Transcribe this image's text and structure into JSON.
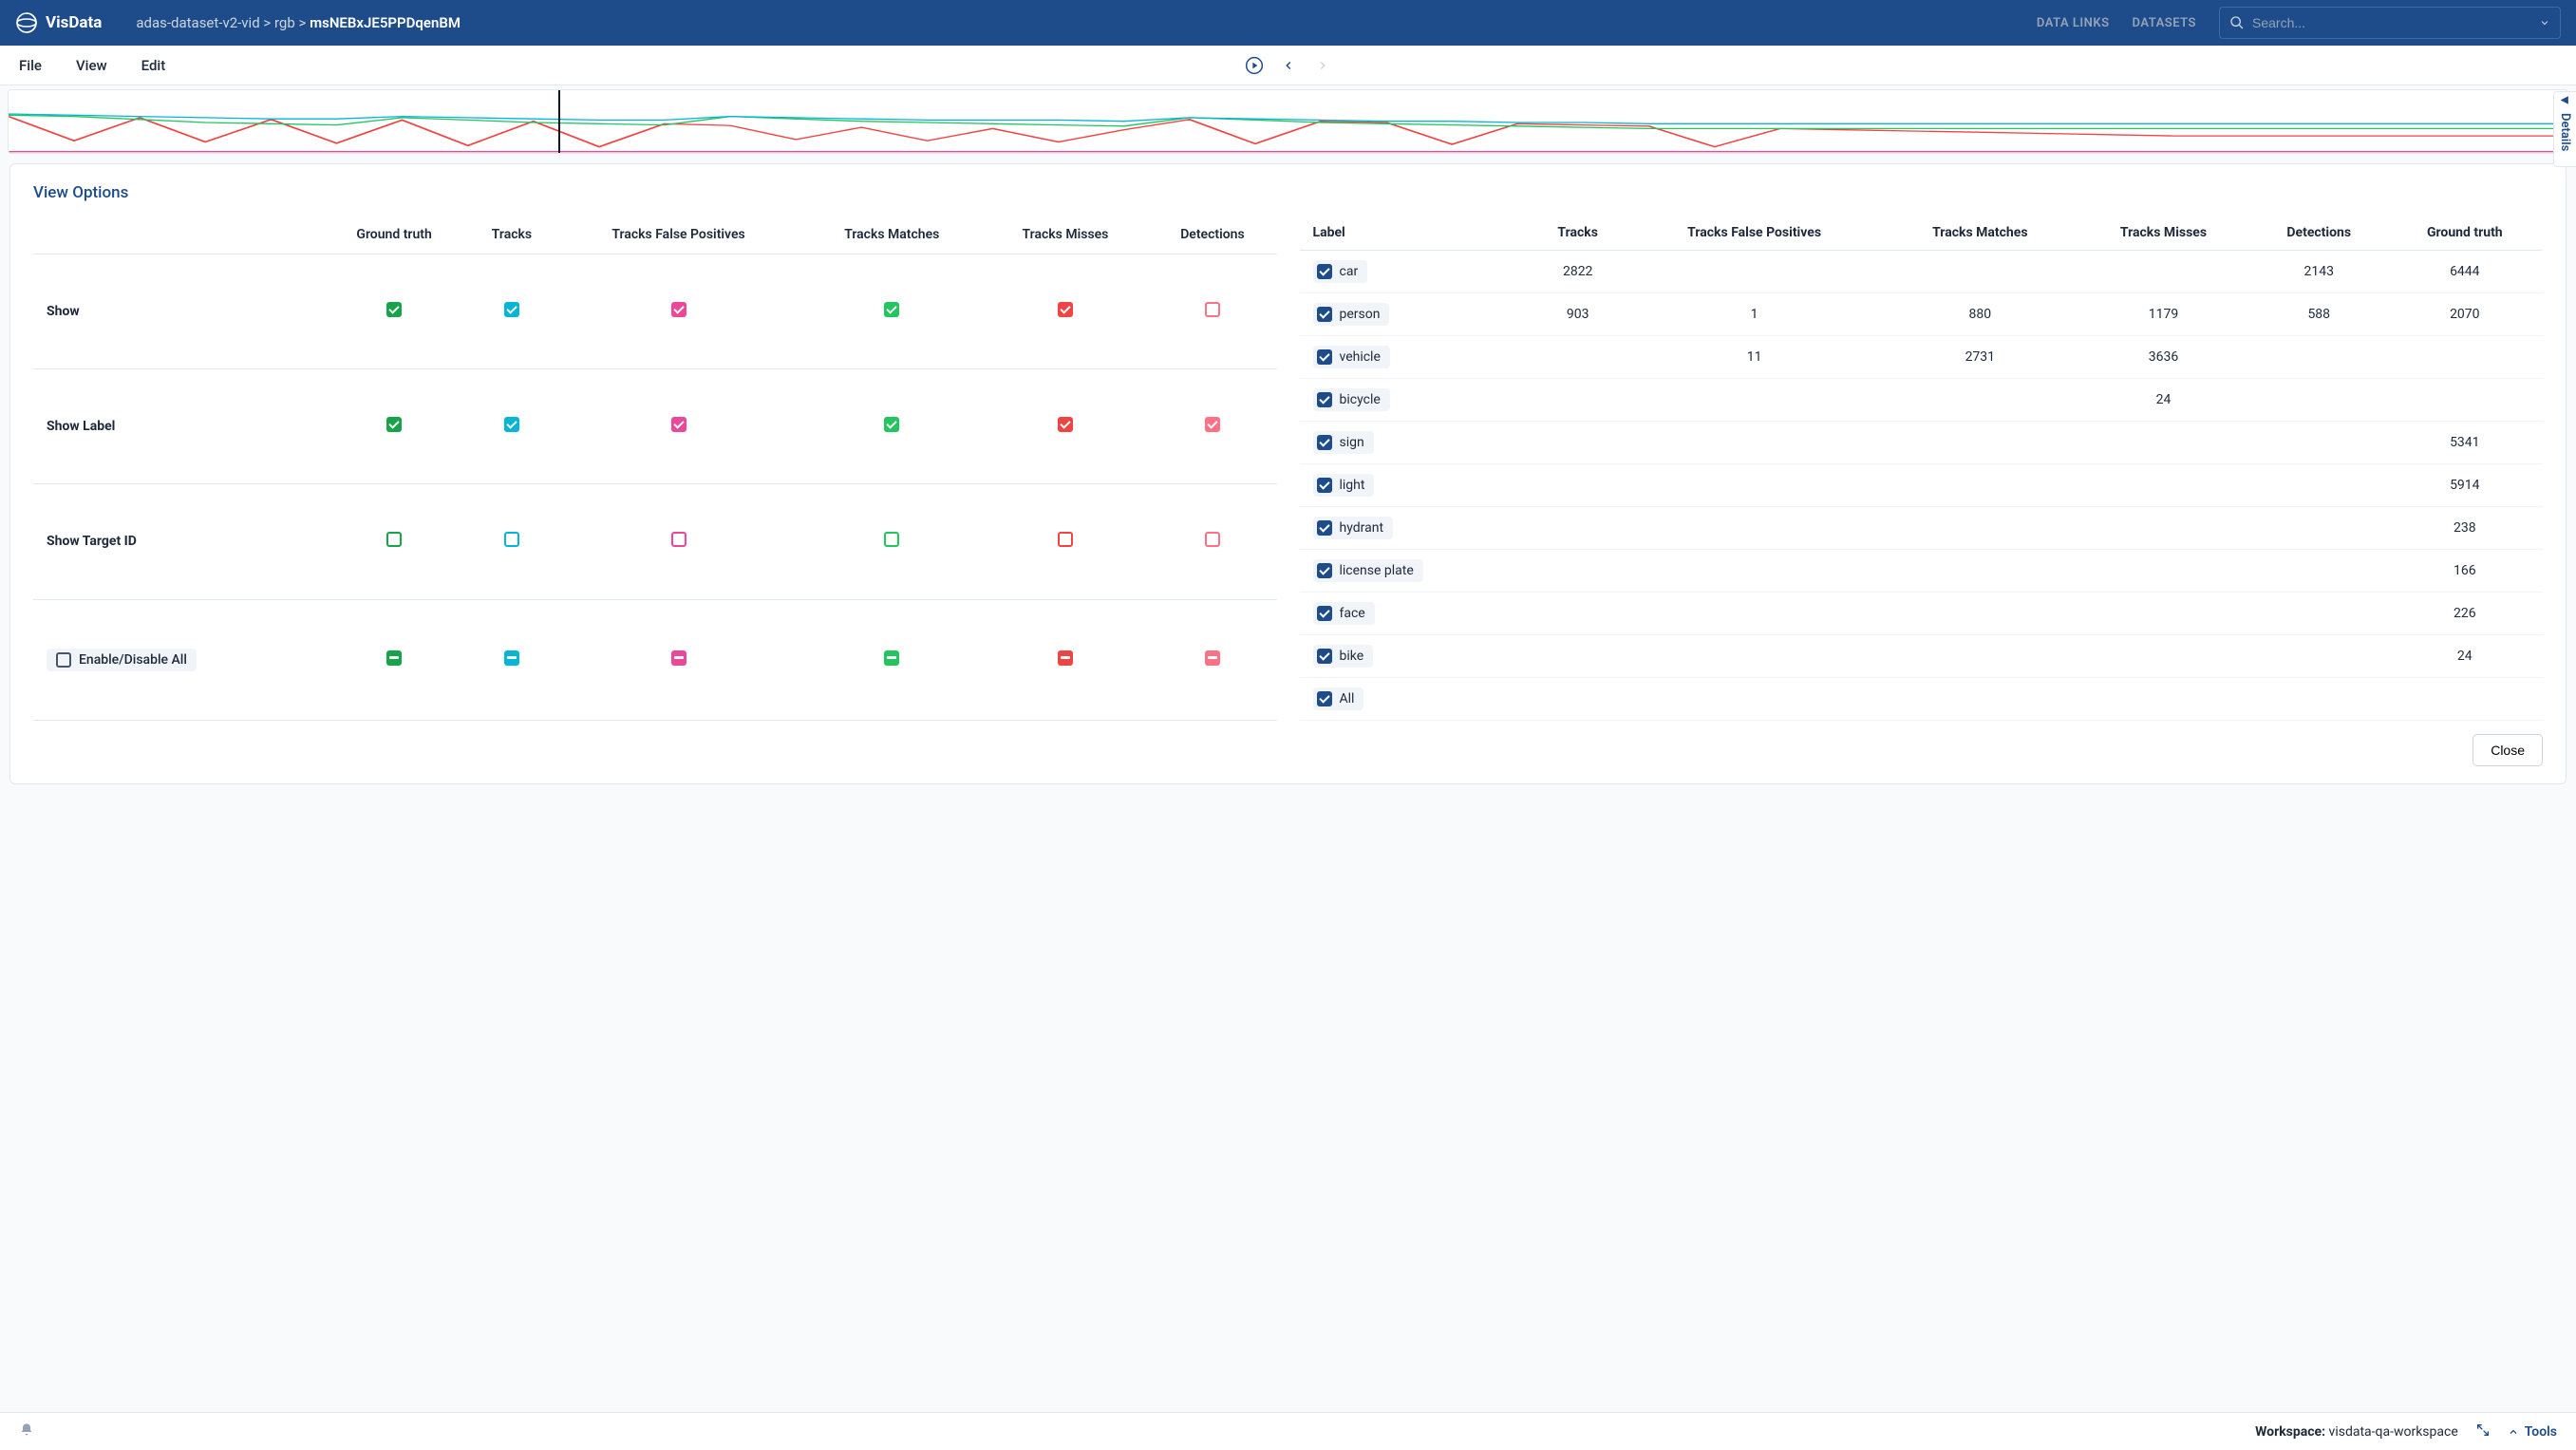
{
  "app_name": "VisData",
  "breadcrumb": {
    "parts": [
      "adas-dataset-v2-vid",
      "rgb"
    ],
    "current": "msNEBxJE5PPDqenBM",
    "sep": " > "
  },
  "nav_links": [
    "DATA LINKS",
    "DATASETS"
  ],
  "search_placeholder": "Search...",
  "menu": [
    "File",
    "View",
    "Edit"
  ],
  "details_tab": "Details",
  "panel_title": "View Options",
  "columns": [
    {
      "key": "gt",
      "label": "Ground truth",
      "color": "green"
    },
    {
      "key": "tr",
      "label": "Tracks",
      "color": "cyan"
    },
    {
      "key": "tfp",
      "label": "Tracks False Positives",
      "color": "magenta"
    },
    {
      "key": "tm",
      "label": "Tracks Matches",
      "color": "lime"
    },
    {
      "key": "tmi",
      "label": "Tracks Misses",
      "color": "red"
    },
    {
      "key": "det",
      "label": "Detections",
      "color": "coral"
    }
  ],
  "option_rows": [
    {
      "label": "Show",
      "states": [
        "checked",
        "checked",
        "checked",
        "checked",
        "checked",
        "unchecked"
      ]
    },
    {
      "label": "Show Label",
      "states": [
        "checked",
        "checked",
        "checked",
        "checked",
        "checked",
        "checked"
      ]
    },
    {
      "label": "Show Target ID",
      "states": [
        "unchecked",
        "unchecked",
        "unchecked",
        "unchecked",
        "unchecked",
        "unchecked"
      ]
    },
    {
      "label": "Enable/Disable All",
      "pill": true,
      "indeterminate": true,
      "states": [
        "indeterminate",
        "indeterminate",
        "indeterminate",
        "indeterminate",
        "indeterminate",
        "indeterminate"
      ]
    }
  ],
  "stats_columns": [
    "Label",
    "Tracks",
    "Tracks False Positives",
    "Tracks Matches",
    "Tracks Misses",
    "Detections",
    "Ground truth"
  ],
  "stats_rows": [
    {
      "label": "car",
      "checked": true,
      "cells": [
        "2822",
        "",
        "",
        "",
        "2143",
        "6444"
      ]
    },
    {
      "label": "person",
      "checked": true,
      "cells": [
        "903",
        "1",
        "880",
        "1179",
        "588",
        "2070"
      ]
    },
    {
      "label": "vehicle",
      "checked": true,
      "cells": [
        "",
        "11",
        "2731",
        "3636",
        "",
        ""
      ]
    },
    {
      "label": "bicycle",
      "checked": true,
      "cells": [
        "",
        "",
        "",
        "24",
        "",
        ""
      ]
    },
    {
      "label": "sign",
      "checked": true,
      "cells": [
        "",
        "",
        "",
        "",
        "",
        "5341"
      ]
    },
    {
      "label": "light",
      "checked": true,
      "cells": [
        "",
        "",
        "",
        "",
        "",
        "5914"
      ]
    },
    {
      "label": "hydrant",
      "checked": true,
      "cells": [
        "",
        "",
        "",
        "",
        "",
        "238"
      ]
    },
    {
      "label": "license plate",
      "checked": true,
      "cells": [
        "",
        "",
        "",
        "",
        "",
        "166"
      ]
    },
    {
      "label": "face",
      "checked": true,
      "cells": [
        "",
        "",
        "",
        "",
        "",
        "226"
      ]
    },
    {
      "label": "bike",
      "checked": true,
      "cells": [
        "",
        "",
        "",
        "",
        "",
        "24"
      ]
    },
    {
      "label": "All",
      "checked": true,
      "cells": [
        "",
        "",
        "",
        "",
        "",
        ""
      ]
    }
  ],
  "close_button": "Close",
  "workspace": {
    "label": "Workspace:",
    "value": "visdata-qa-workspace"
  },
  "tools_label": "Tools",
  "chart_data": {
    "type": "line",
    "note": "Timeline overview strip with 4–5 colored series; values are approximate relative heights sampled across the width (0–100 normalized).",
    "x_range": [
      0,
      100
    ],
    "playhead_x": 21.5,
    "series": [
      {
        "name": "red",
        "color": "#ef4444",
        "values": [
          60,
          20,
          58,
          18,
          55,
          16,
          54,
          12,
          52,
          10,
          48,
          45,
          22,
          42,
          20,
          40,
          18,
          38,
          55,
          15,
          52,
          50,
          14,
          48,
          46,
          44,
          10,
          40,
          38,
          36,
          34,
          32,
          30,
          28,
          28,
          28,
          28,
          28,
          28,
          28
        ]
      },
      {
        "name": "green",
        "color": "#22c55e",
        "values": [
          62,
          60,
          55,
          50,
          48,
          46,
          58,
          54,
          50,
          48,
          46,
          60,
          56,
          52,
          50,
          48,
          46,
          44,
          58,
          54,
          50,
          48,
          46,
          44,
          42,
          40,
          40,
          40,
          40,
          40,
          40,
          40,
          40,
          40,
          40,
          40,
          40,
          40,
          40,
          40
        ]
      },
      {
        "name": "cyan",
        "color": "#06b6d4",
        "values": [
          64,
          62,
          60,
          58,
          56,
          56,
          60,
          58,
          56,
          54,
          54,
          60,
          58,
          56,
          54,
          54,
          54,
          52,
          58,
          56,
          54,
          52,
          52,
          50,
          50,
          48,
          48,
          48,
          48,
          48,
          48,
          48,
          48,
          48,
          48,
          48,
          48,
          48,
          48,
          48
        ]
      },
      {
        "name": "magenta",
        "color": "#ec4899",
        "values": [
          2,
          2,
          2,
          2,
          2,
          2,
          2,
          2,
          2,
          2,
          2,
          2,
          2,
          2,
          2,
          2,
          2,
          2,
          2,
          2,
          2,
          2,
          2,
          2,
          2,
          2,
          2,
          2,
          2,
          2,
          2,
          2,
          2,
          2,
          2,
          2,
          2,
          2,
          2,
          2
        ]
      }
    ]
  }
}
